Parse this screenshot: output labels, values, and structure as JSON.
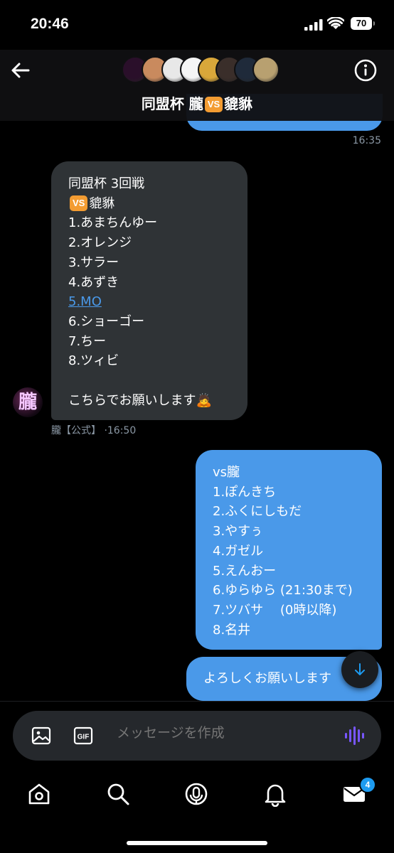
{
  "status_bar": {
    "time": "20:46",
    "battery": "70"
  },
  "header": {
    "title_before": "同盟杯 朧",
    "vs_badge": "VS",
    "title_after": "貔貅",
    "member_avatar_colors": [
      "#2a0f2a",
      "#c98a5e",
      "#e8e8e8",
      "#f5f5f5",
      "#d9a73a",
      "#3a2e2a",
      "#1f2a3a",
      "#b8a070",
      "#5a2a2a"
    ]
  },
  "messages": {
    "prev_time": "16:35",
    "incoming": {
      "lines": [
        "同盟杯 3回戦",
        "貔貅",
        "1.あまちんゆー",
        "2.オレンジ",
        "3.サラー",
        "4.あずき",
        "5.MO",
        "6.ショーゴー",
        "7.ちー",
        "8.ツィビ",
        "",
        "こちらでお願いします"
      ],
      "vs_badge": "VS",
      "emoji": "🙇",
      "sender": "朧【公式】",
      "time": "·16:50",
      "avatar_text": "朧"
    },
    "outgoing": {
      "lines": [
        "vs朧",
        "1.ぽんきち",
        "2.ふくにしもだ",
        "3.やすぅ",
        "4.ガゼル",
        "5.えんおー",
        "6.ゆらゆら (21:30まで)",
        "7.ツバサ　 (0時以降)",
        "8.名井"
      ]
    },
    "outgoing2": {
      "text": "よろしくお願いします"
    }
  },
  "composer": {
    "placeholder": "メッセージを作成",
    "gif_label": "GIF"
  },
  "tab_bar": {
    "messages_badge": "4"
  },
  "colors": {
    "bubble_out": "#4a99e9",
    "bubble_in": "#2f3336",
    "accent": "#1d9bf0",
    "voice": "#7856ff"
  }
}
